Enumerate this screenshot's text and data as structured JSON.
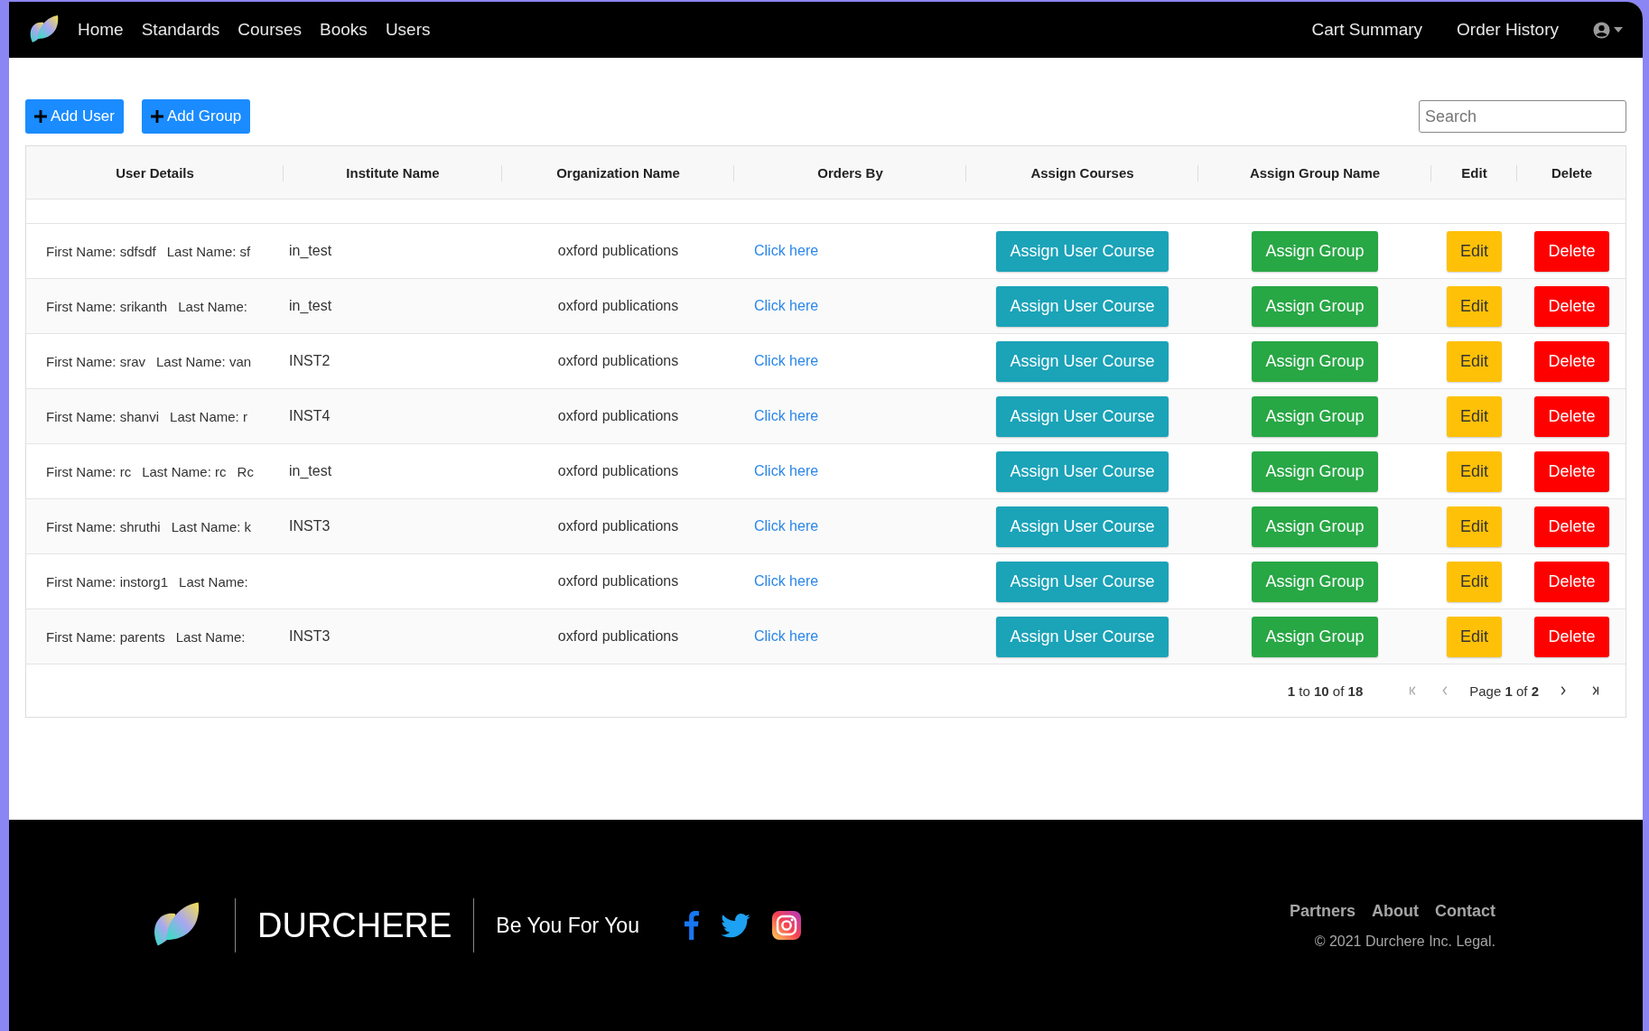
{
  "nav": {
    "links": [
      "Home",
      "Standards",
      "Courses",
      "Books",
      "Users"
    ],
    "account_links": [
      "Cart Summary",
      "Order History"
    ]
  },
  "toolbar": {
    "buttons": [
      "Add User",
      "Add Group"
    ],
    "search": {
      "placeholder": "Search"
    }
  },
  "table": {
    "columns": [
      "User Details",
      "Institute Name",
      "Organization Name",
      "Orders By",
      "Assign Courses",
      "Assign Group Name",
      "Edit",
      "Delete"
    ],
    "rows": [
      {
        "user_details": [
          "First Name: sdfsdf",
          "Last Name: sf"
        ],
        "institute_name": "in_test",
        "organization_name": "oxford publications",
        "orders_by": "Click here",
        "assign_course": "Assign User Course",
        "assign_group": "Assign Group",
        "edit": "Edit",
        "delete": "Delete"
      },
      {
        "user_details": [
          "First Name: srikanth",
          "Last Name:"
        ],
        "institute_name": "in_test",
        "organization_name": "oxford publications",
        "orders_by": "Click here",
        "assign_course": "Assign User Course",
        "assign_group": "Assign Group",
        "edit": "Edit",
        "delete": "Delete"
      },
      {
        "user_details": [
          "First Name: srav",
          "Last Name: van"
        ],
        "institute_name": "INST2",
        "organization_name": "oxford publications",
        "orders_by": "Click here",
        "assign_course": "Assign User Course",
        "assign_group": "Assign Group",
        "edit": "Edit",
        "delete": "Delete"
      },
      {
        "user_details": [
          "First Name: shanvi",
          "Last Name: r"
        ],
        "institute_name": "INST4",
        "organization_name": "oxford publications",
        "orders_by": "Click here",
        "assign_course": "Assign User Course",
        "assign_group": "Assign Group",
        "edit": "Edit",
        "delete": "Delete"
      },
      {
        "user_details": [
          "First Name: rc",
          "Last Name: rc",
          "Rc"
        ],
        "institute_name": "in_test",
        "organization_name": "oxford publications",
        "orders_by": "Click here",
        "assign_course": "Assign User Course",
        "assign_group": "Assign Group",
        "edit": "Edit",
        "delete": "Delete"
      },
      {
        "user_details": [
          "First Name: shruthi",
          "Last Name: k"
        ],
        "institute_name": "INST3",
        "organization_name": "oxford publications",
        "orders_by": "Click here",
        "assign_course": "Assign User Course",
        "assign_group": "Assign Group",
        "edit": "Edit",
        "delete": "Delete"
      },
      {
        "user_details": [
          "First Name: instorg1",
          "Last Name:"
        ],
        "organization_name": "oxford publications",
        "orders_by": "Click here",
        "assign_course": "Assign User Course",
        "assign_group": "Assign Group",
        "edit": "Edit",
        "delete": "Delete"
      },
      {
        "user_details": [
          "First Name: parents",
          "Last Name:"
        ],
        "institute_name": "INST3",
        "organization_name": "oxford publications",
        "orders_by": "Click here",
        "assign_course": "Assign User Course",
        "assign_group": "Assign Group",
        "edit": "Edit",
        "delete": "Delete"
      }
    ]
  },
  "pagination": {
    "summary": "**1** to **10** of **18**",
    "page": "Page **1** of **2**",
    "controls": [
      {
        "kind": "first",
        "disabled": true
      },
      {
        "kind": "prev",
        "disabled": true
      },
      {
        "kind": "next",
        "disabled": false
      },
      {
        "kind": "last",
        "disabled": false
      }
    ]
  },
  "footer": {
    "brand": "DURCHERE",
    "tagline": "Be You For You",
    "social": [
      {
        "kind": "facebook"
      },
      {
        "kind": "twitter"
      },
      {
        "kind": "instagram"
      }
    ],
    "links": [
      "Partners",
      "About",
      "Contact"
    ],
    "copyright": "© 2021 Durchere Inc. Legal."
  }
}
